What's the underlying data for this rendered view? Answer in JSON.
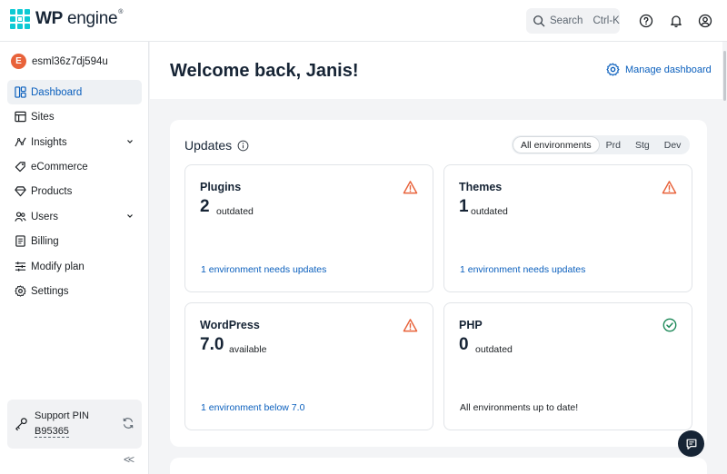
{
  "brand": {
    "name_bold": "WP",
    "name_rest": " engine",
    "mark": "®"
  },
  "search": {
    "label": "Search",
    "shortcut": "Ctrl-K"
  },
  "account": {
    "initial": "E",
    "name": "esml36z7dj594u"
  },
  "sidebar": {
    "items": [
      {
        "label": "Dashboard",
        "icon": "dashboard-icon"
      },
      {
        "label": "Sites",
        "icon": "sites-icon"
      },
      {
        "label": "Insights",
        "icon": "insights-icon"
      },
      {
        "label": "eCommerce",
        "icon": "tag-icon"
      },
      {
        "label": "Products",
        "icon": "gem-icon"
      },
      {
        "label": "Users",
        "icon": "users-icon"
      },
      {
        "label": "Billing",
        "icon": "billing-icon"
      },
      {
        "label": "Modify plan",
        "icon": "sliders-icon"
      },
      {
        "label": "Settings",
        "icon": "gear-icon"
      }
    ],
    "support": {
      "title": "Support PIN",
      "pin": "B95365"
    },
    "collapse": "<<"
  },
  "main": {
    "welcome": "Welcome back, Janis!",
    "manage": "Manage dashboard",
    "updates": {
      "title": "Updates",
      "filters": [
        "All environments",
        "Prd",
        "Stg",
        "Dev"
      ],
      "cards": [
        {
          "title": "Plugins",
          "count": "2",
          "count_label": "outdated",
          "footer": "1 environment needs updates",
          "status": "warning"
        },
        {
          "title": "Themes",
          "count": "1",
          "count_label": "outdated",
          "footer": "1 environment needs updates",
          "status": "warning"
        },
        {
          "title": "WordPress",
          "count": "7.0",
          "count_label": "available",
          "footer": "1 environment below 7.0",
          "status": "warning"
        },
        {
          "title": "PHP",
          "count": "0",
          "count_label": "outdated",
          "footer": "All environments up to date!",
          "status": "ok"
        }
      ]
    }
  },
  "colors": {
    "accent": "#0a5fbd",
    "warning": "#e8623a",
    "ok": "#1f8a5a",
    "brand": "#0ecad4"
  }
}
